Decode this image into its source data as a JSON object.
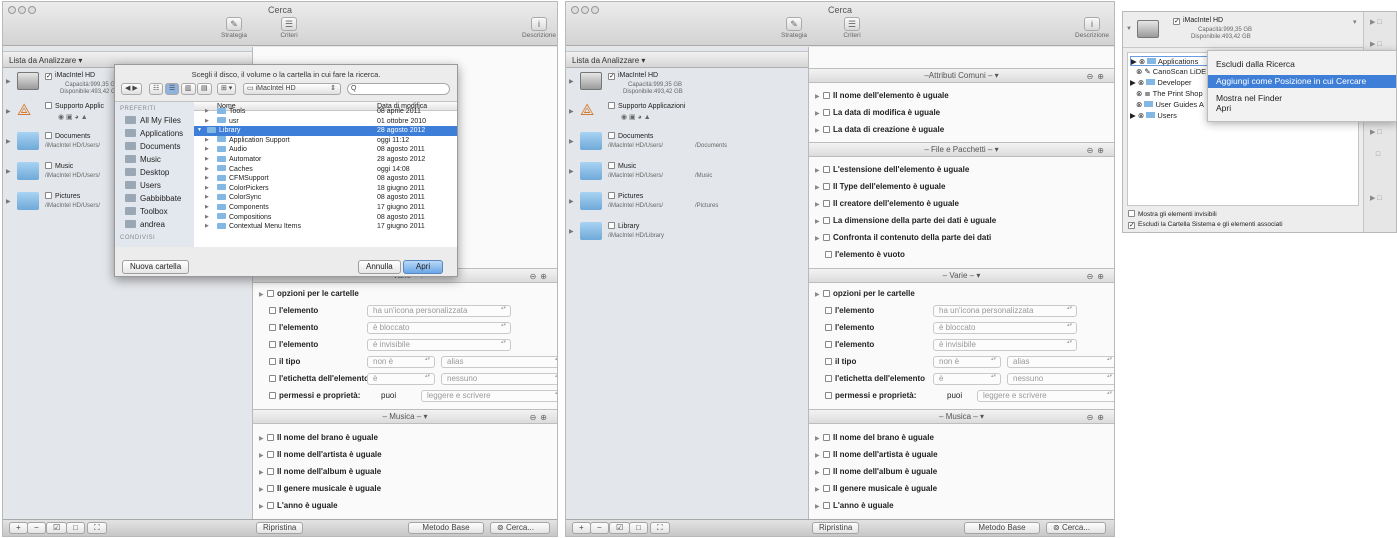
{
  "window_title": "Cerca",
  "toolbar": {
    "strategy": "Strategia",
    "criteria": "Criteri",
    "description": "Descrizione"
  },
  "left": {
    "header": "Lista da Analizzare",
    "volume": {
      "name": "iMacIntel HD",
      "capacity": "Capacità:999,35 GB",
      "available": "Disponibile:493,42 GB"
    },
    "support_label": "Supporto Applicazioni",
    "support_label_cut": "Supporto Applic",
    "items": [
      {
        "name": "Documents",
        "path": "/iMacIntel HD/Users/",
        "path_full": "/Documents"
      },
      {
        "name": "Music",
        "path": "/iMacIntel HD/Users/",
        "path_full": "/Music"
      },
      {
        "name": "Pictures",
        "path": "/iMacIntel HD/Users/",
        "path_full": "/Pictures"
      }
    ],
    "library": {
      "name": "Library",
      "path": "/iMacIntel HD/Library"
    }
  },
  "sections": {
    "common": "–Attributi Comuni –",
    "files": "– File e Pacchetti –",
    "misc": "– Varie –",
    "music": "– Musica –"
  },
  "common_rows": [
    "Il nome dell'elemento è uguale",
    "La data di modifica è uguale",
    "La data di creazione è uguale"
  ],
  "file_rows": [
    "L'estensione dell'elemento è uguale",
    "Il Type dell'elemento è uguale",
    "Il creatore dell'elemento è uguale",
    "La dimensione della parte dei dati è uguale",
    "Confronta il contenuto della parte dei dati",
    "l'elemento è vuoto"
  ],
  "misc": {
    "folder_options": "opzioni per le cartelle",
    "element": "l'elemento",
    "custom_icon": "ha un'icona personalizzata",
    "locked": "è bloccato",
    "invisible": "è invisibile",
    "type": "il tipo",
    "not_is": "non è",
    "alias": "alias",
    "label": "l'etichetta dell'elemento",
    "is": "è",
    "none": "nessuno",
    "permissions": "permessi e proprietà:",
    "can": "puoi",
    "read_write": "leggere e scrivere"
  },
  "music_rows": [
    "Il nome del brano è uguale",
    "Il nome dell'artista è uguale",
    "Il nome dell'album è uguale",
    "Il genere musicale è uguale",
    "L'anno è uguale"
  ],
  "bottom": {
    "reset": "Ripristina",
    "method": "Metodo Base",
    "search": "Cerca..."
  },
  "dialog": {
    "title": "Scegli il disco, il volume o la cartella in cui fare la ricerca.",
    "location": "iMacIntel HD",
    "search_placeholder": "Q",
    "sidebar_header": "PREFERITI",
    "sidebar": [
      "All My Files",
      "Applications",
      "Documents",
      "Music",
      "Desktop",
      "Users",
      "Gabbibbate",
      "Toolbox",
      "andrea"
    ],
    "shared_header": "CONDIVISI",
    "col_name": "Nome",
    "col_date": "Data di modifica",
    "files": [
      {
        "n": "Tools",
        "d": "08 aprile 2011"
      },
      {
        "n": "usr",
        "d": "01 ottobre 2010"
      },
      {
        "n": "Library",
        "d": "28 agosto 2012",
        "sel": true
      },
      {
        "n": "Application Support",
        "d": "oggi 11:12"
      },
      {
        "n": "Audio",
        "d": "08 agosto 2011"
      },
      {
        "n": "Automator",
        "d": "28 agosto 2012"
      },
      {
        "n": "Caches",
        "d": "oggi 14:08"
      },
      {
        "n": "CFMSupport",
        "d": "08 agosto 2011"
      },
      {
        "n": "ColorPickers",
        "d": "18 giugno 2011"
      },
      {
        "n": "ColorSync",
        "d": "08 agosto 2011"
      },
      {
        "n": "Components",
        "d": "17 giugno 2011"
      },
      {
        "n": "Compositions",
        "d": "08 agosto 2011"
      },
      {
        "n": "Contextual Menu Items",
        "d": "17 giugno 2011"
      }
    ],
    "new_folder": "Nuova cartella",
    "cancel": "Annulla",
    "open": "Apri"
  },
  "panel3": {
    "volume": "iMacIntel HD",
    "capacity": "Capacità:999,35 GB",
    "available": "Disponibile:493,42 GB",
    "tree": [
      "Applications",
      "CanoScan LiDE",
      "Developer",
      "The Print Shop",
      "User Guides A",
      "Users"
    ],
    "show_invisible": "Mostra gli elementi invisibili",
    "exclude_system": "Escludi la Cartella Sistema e gli elementi associati"
  },
  "context_menu": [
    "Escludi dalla Ricerca",
    "Aggiungi come Posizione in cui Cercare",
    "Mostra nel Finder",
    "Apri"
  ]
}
